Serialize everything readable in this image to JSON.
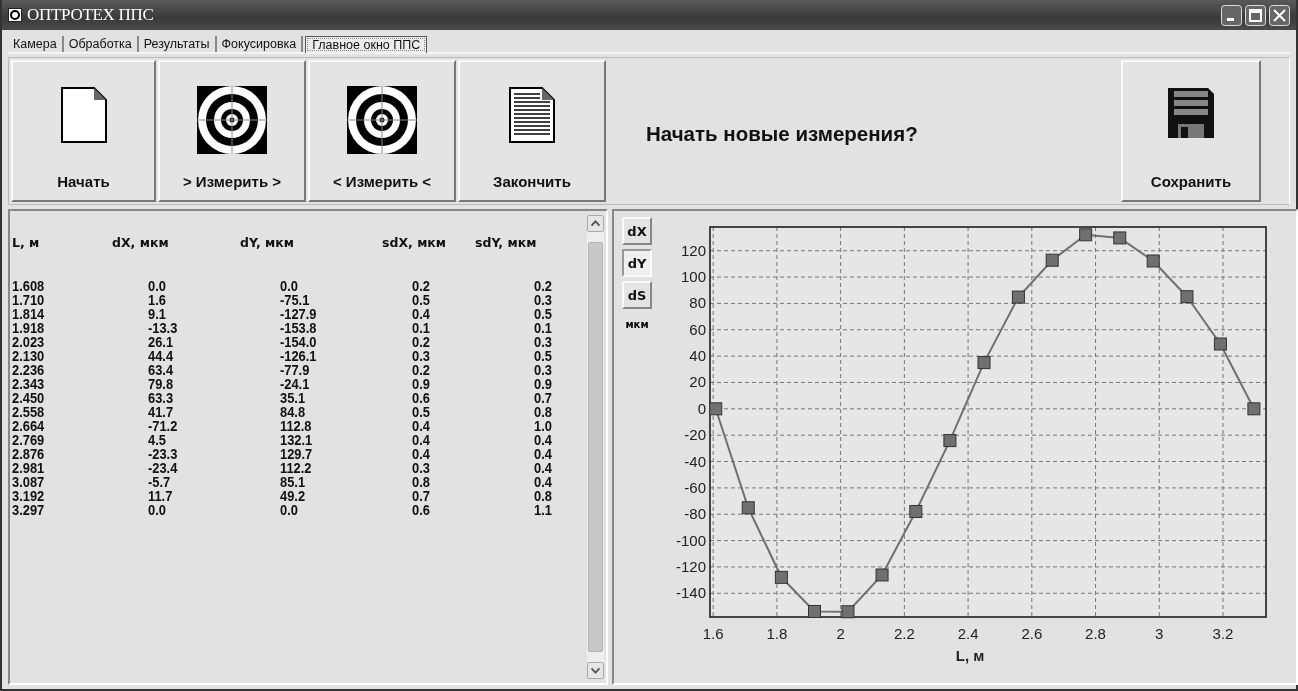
{
  "window": {
    "title": "ОПТРОТЕХ ППС"
  },
  "tabs": [
    {
      "label": "Камера",
      "selected": false
    },
    {
      "label": "Обработка",
      "selected": false
    },
    {
      "label": "Результаты",
      "selected": false
    },
    {
      "label": "Фокусировка",
      "selected": false
    },
    {
      "label": "Главное окно ППС",
      "selected": true
    }
  ],
  "toolbar": {
    "buttons": [
      {
        "label": "Начать",
        "kind": "blank-page"
      },
      {
        "label": "> Измерить >",
        "kind": "target"
      },
      {
        "label": "< Измерить <",
        "kind": "target"
      },
      {
        "label": "Закончить",
        "kind": "text-page"
      }
    ],
    "prompt": "Начать новые измерения?",
    "save_button": {
      "label": "Сохранить",
      "kind": "floppy"
    }
  },
  "table": {
    "columns": [
      "L, м",
      "dX, мкм",
      "dY, мкм",
      "sdX, мкм",
      "sdY, мкм"
    ],
    "rows": [
      [
        "1.608",
        "0.0",
        "0.0",
        "0.2",
        "0.2"
      ],
      [
        "1.710",
        "1.6",
        "-75.1",
        "0.5",
        "0.3"
      ],
      [
        "1.814",
        "9.1",
        "-127.9",
        "0.4",
        "0.5"
      ],
      [
        "1.918",
        "-13.3",
        "-153.8",
        "0.1",
        "0.1"
      ],
      [
        "2.023",
        "26.1",
        "-154.0",
        "0.2",
        "0.3"
      ],
      [
        "2.130",
        "44.4",
        "-126.1",
        "0.3",
        "0.5"
      ],
      [
        "2.236",
        "63.4",
        "-77.9",
        "0.2",
        "0.3"
      ],
      [
        "2.343",
        "79.8",
        "-24.1",
        "0.9",
        "0.9"
      ],
      [
        "2.450",
        "63.3",
        "35.1",
        "0.6",
        "0.7"
      ],
      [
        "2.558",
        "41.7",
        "84.8",
        "0.5",
        "0.8"
      ],
      [
        "2.664",
        "-71.2",
        "112.8",
        "0.4",
        "1.0"
      ],
      [
        "2.769",
        "4.5",
        "132.1",
        "0.4",
        "0.4"
      ],
      [
        "2.876",
        "-23.3",
        "129.7",
        "0.4",
        "0.4"
      ],
      [
        "2.981",
        "-23.4",
        "112.2",
        "0.3",
        "0.4"
      ],
      [
        "3.087",
        "-5.7",
        "85.1",
        "0.8",
        "0.4"
      ],
      [
        "3.192",
        "11.7",
        "49.2",
        "0.7",
        "0.8"
      ],
      [
        "3.297",
        "0.0",
        "0.0",
        "0.6",
        "1.1"
      ]
    ]
  },
  "chart_panel": {
    "series_buttons": [
      {
        "label": "dX",
        "selected": false
      },
      {
        "label": "dY",
        "selected": true
      },
      {
        "label": "dS",
        "selected": false
      }
    ],
    "unit": "мкм",
    "chart_data": {
      "type": "line",
      "xlabel": "L, м",
      "x": [
        1.608,
        1.71,
        1.814,
        1.918,
        2.023,
        2.13,
        2.236,
        2.343,
        2.45,
        2.558,
        2.664,
        2.769,
        2.876,
        2.981,
        3.087,
        3.192,
        3.297
      ],
      "grid": true,
      "series": [
        {
          "color": "#707070",
          "marker": "square",
          "values": [
            0.0,
            -75.1,
            -127.9,
            -153.8,
            -154.0,
            -126.1,
            -77.9,
            -24.1,
            35.1,
            84.8,
            112.8,
            132.1,
            129.7,
            112.2,
            85.1,
            49.2,
            0.0
          ]
        }
      ],
      "xlim": [
        1.59,
        3.335
      ],
      "ylim": [
        -158,
        138
      ],
      "xticks": [
        {
          "value": 1.6,
          "label": "1.6"
        },
        {
          "value": 1.8,
          "label": "1.8"
        },
        {
          "value": 2,
          "label": "2"
        },
        {
          "value": 2.2,
          "label": "2.2"
        },
        {
          "value": 2.4,
          "label": "2.4"
        },
        {
          "value": 2.6,
          "label": "2.6"
        },
        {
          "value": 2.8,
          "label": "2.8"
        },
        {
          "value": 3,
          "label": "3"
        },
        {
          "value": 3.2,
          "label": "3.2"
        }
      ],
      "yticks": [
        -140,
        -120,
        -100,
        -80,
        -60,
        -40,
        -20,
        0,
        20,
        40,
        60,
        80,
        100,
        120
      ]
    }
  }
}
